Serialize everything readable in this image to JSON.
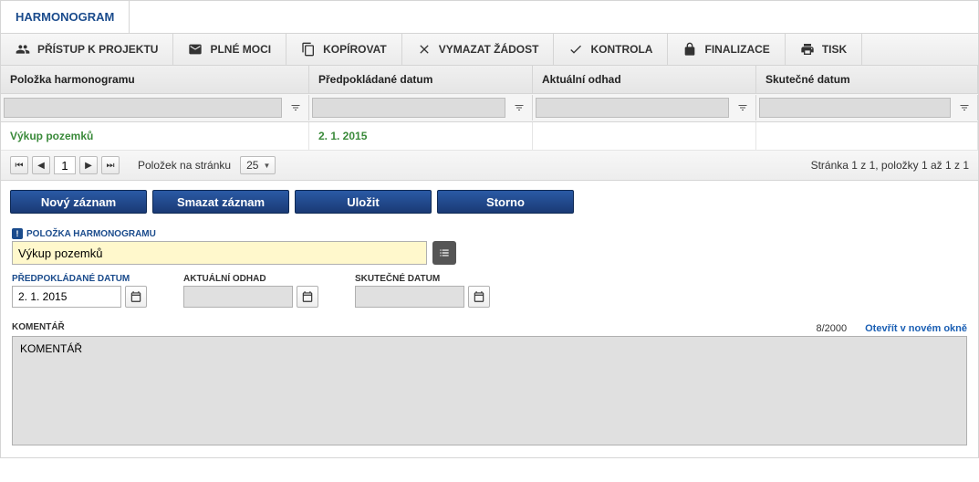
{
  "tab": {
    "title": "HARMONOGRAM"
  },
  "toolbar": {
    "access": "PŘÍSTUP K PROJEKTU",
    "power": "PLNÉ MOCI",
    "copy": "KOPÍROVAT",
    "delete": "VYMAZAT ŽÁDOST",
    "check": "KONTROLA",
    "finalize": "FINALIZACE",
    "print": "TISK"
  },
  "grid": {
    "headers": {
      "item": "Položka harmonogramu",
      "planned": "Předpokládané datum",
      "estimate": "Aktuální odhad",
      "actual": "Skutečné datum"
    },
    "row": {
      "item": "Výkup pozemků",
      "planned": "2. 1. 2015",
      "estimate": "",
      "actual": ""
    }
  },
  "pager": {
    "page": "1",
    "perPageLabel": "Položek na stránku",
    "perPage": "25",
    "status": "Stránka 1 z 1, položky 1 až 1 z 1"
  },
  "actions": {
    "new": "Nový záznam",
    "delete": "Smazat záznam",
    "save": "Uložit",
    "cancel": "Storno"
  },
  "form": {
    "itemLabel": "POLOŽKA HARMONOGRAMU",
    "itemValue": "Výkup pozemků",
    "plannedLabel": "PŘEDPOKLÁDANÉ DATUM",
    "plannedValue": "2. 1. 2015",
    "estimateLabel": "AKTUÁLNÍ ODHAD",
    "estimateValue": "",
    "actualLabel": "SKUTEČNÉ DATUM",
    "actualValue": "",
    "commentLabel": "KOMENTÁŘ",
    "commentCount": "8/2000",
    "commentLink": "Otevřít v novém okně",
    "commentValue": "KOMENTÁŘ"
  }
}
